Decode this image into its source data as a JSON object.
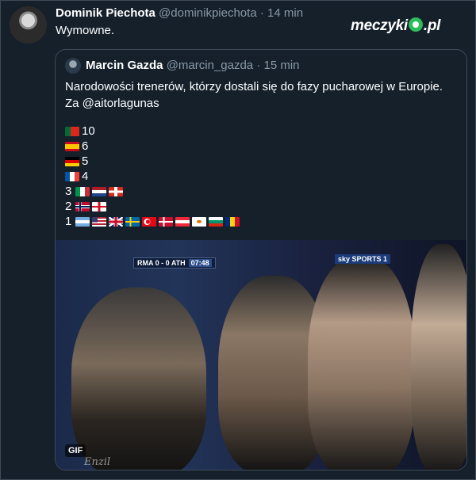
{
  "tweet": {
    "author_name": "Dominik Piechota",
    "handle": "@dominikpiechota",
    "separator": "·",
    "time": "14 min",
    "text": "Wymowne."
  },
  "brand_logo": {
    "text_left": "meczyki",
    "text_right": ".pl",
    "accent": "#2ebd5a"
  },
  "quoted": {
    "author_name": "Marcin Gazda",
    "handle": "@marcin_gazda",
    "separator": "·",
    "time": "15 min",
    "text_line1": "Narodowości trenerów, którzy dostali się do fazy pucharowej w Europie.",
    "text_line2": "Za @aitorlagunas",
    "stats": [
      {
        "count": "10",
        "flags": [
          "portugal"
        ],
        "count_first": false
      },
      {
        "count": "6",
        "flags": [
          "spain"
        ],
        "count_first": false
      },
      {
        "count": "5",
        "flags": [
          "germany"
        ],
        "count_first": false
      },
      {
        "count": "4",
        "flags": [
          "france"
        ],
        "count_first": false
      },
      {
        "count": "3",
        "flags": [
          "italy",
          "netherlands",
          "switzerland"
        ],
        "count_first": true
      },
      {
        "count": "2",
        "flags": [
          "norway",
          "england"
        ],
        "count_first": true
      },
      {
        "count": "1",
        "flags": [
          "argentina",
          "usa",
          "uk",
          "sweden",
          "turkey",
          "denmark",
          "austria",
          "cyprus",
          "bulgaria",
          "romania"
        ],
        "count_first": true
      }
    ],
    "media": {
      "scoreboard": "RMA 0 - 0 ATH",
      "clock": "07:48",
      "channel_logo": "sky SPORTS 1",
      "badge": "GIF",
      "watermark": "Enzil"
    }
  },
  "colors": {
    "background": "#15202b",
    "muted": "#8899a6",
    "border": "#3d4a57"
  }
}
